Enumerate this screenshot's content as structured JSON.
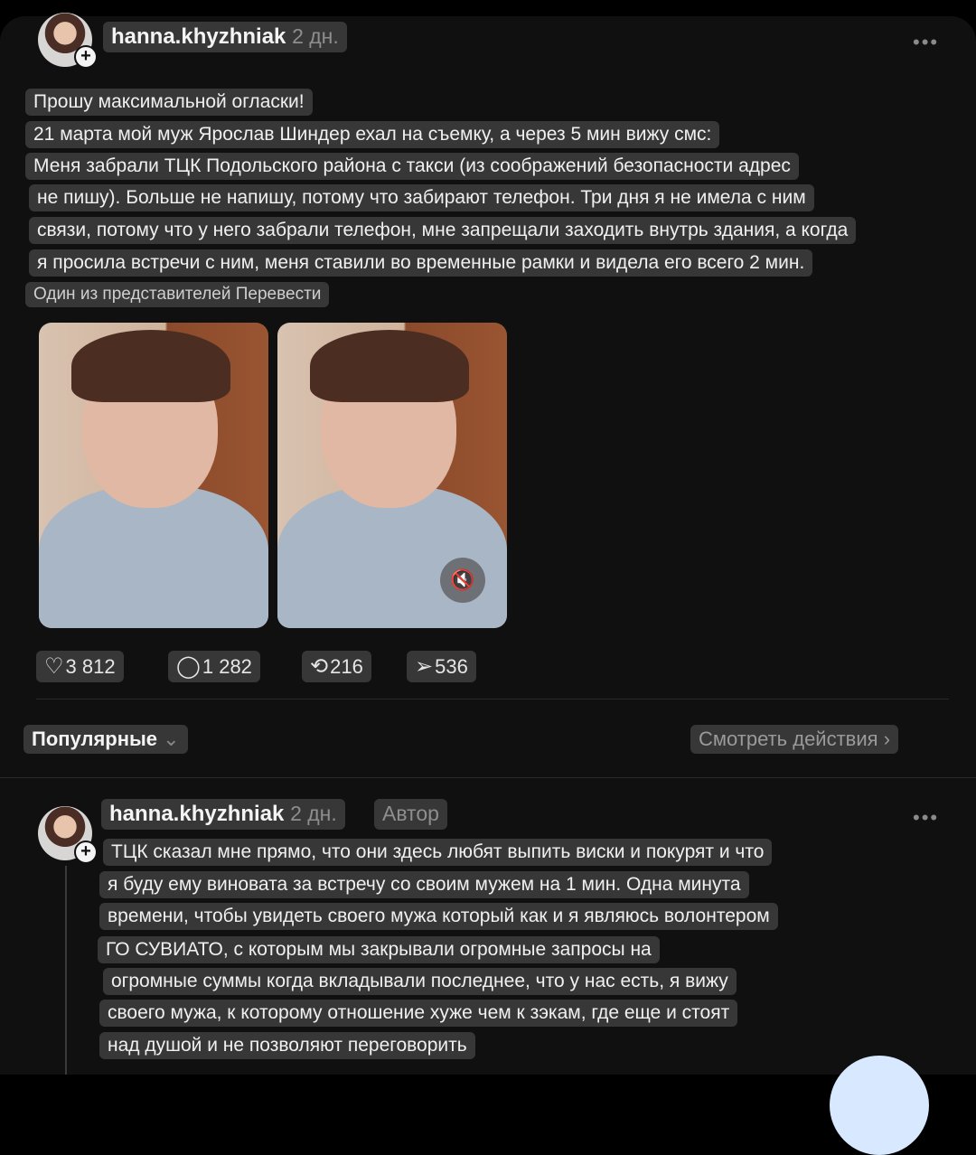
{
  "post": {
    "username": "hanna.khyzhniak",
    "time": "2 дн.",
    "more": "•••",
    "lines": [
      "Прошу максимальной огласки!",
      "21 марта мой муж Ярослав Шиндер ехал на съемку, а через 5 мин вижу смс:",
      "Меня забрали ТЦК Подольского района с такси (из соображений безопасности адрес",
      "не пишу). Больше не напишу, потому что забирают телефон. Три дня я не имела с ним",
      "связи, потому что у него забрали телефон, мне запрещали заходить внутрь здания, а когда",
      "я просила встречи с ним, меня ставили во временные рамки и видела его всего 2 мин."
    ],
    "footer_line": "Один из представителей Перевести",
    "stats": {
      "likes": "3 812",
      "comments": "1 282",
      "reposts": "216",
      "shares": "536"
    }
  },
  "toolbar": {
    "sort_label": "Популярные",
    "actions_label": "Смотреть действия"
  },
  "reply": {
    "username": "hanna.khyzhniak",
    "time": "2 дн.",
    "badge": "Автор",
    "more": "•••",
    "lines": [
      "ТЦК сказал мне прямо, что они здесь любят выпить виски и покурят и что",
      "я буду ему виновата за встречу со своим мужем на 1 мин. Одна минута",
      "времени, чтобы увидеть своего мужа который как и я являюсь волонтером",
      "ГО СУВИАТО, с которым мы закрывали огромные запросы на",
      "огромные суммы когда вкладывали последнее, что у нас есть, я вижу",
      "своего мужа, к которому отношение хуже чем к зэкам, где еще и стоят",
      "над душой и не позволяют переговорить"
    ]
  },
  "icons": {
    "heart": "heart-icon",
    "comment": "comment-icon",
    "repost": "repost-icon",
    "share": "share-icon",
    "mute": "mute-icon"
  }
}
